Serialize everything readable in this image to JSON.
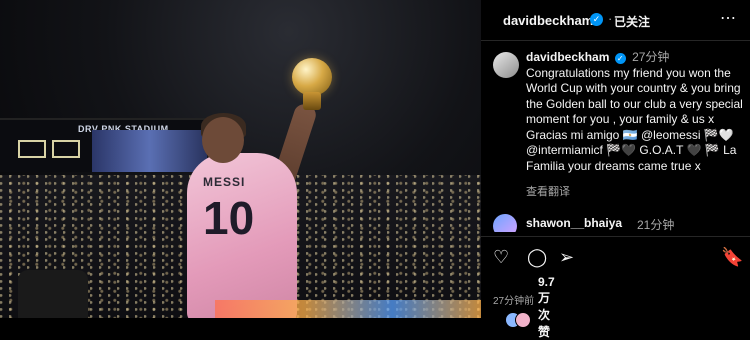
{
  "post": {
    "header": {
      "username": "davidbeckham",
      "follow_status": "已关注",
      "more": "⋯"
    },
    "caption": {
      "username": "davidbeckham",
      "time": "27分钟",
      "text": "Congratulations my friend you won the World Cup with your country & you bring the Golden ball to our club a very special moment for you , your family & us x Gracias mi amigo 🇦🇷 @leomessi 🏁🤍 @intermiamicf 🏁🖤 G.O.A.T 🖤 🏁 La Familia your dreams came true x",
      "translate": "查看翻译"
    },
    "reply": {
      "username": "shawon__bhaiya",
      "time": "21分钟"
    },
    "actions": {
      "like": "♡",
      "comment": "◯",
      "share": "➢",
      "save": "🔖"
    },
    "likes": "9.7万次赞",
    "timestamp": "27分钟前"
  },
  "icons": {
    "verified": "✓"
  },
  "photo": {
    "stadium": "DRV PNK STADIUM",
    "jersey_name": "MESSI",
    "jersey_number": "10",
    "score_left": "",
    "score_right": ""
  },
  "colors": {
    "accent": "#0095f6",
    "secondary_text": "#a8a8a8"
  }
}
